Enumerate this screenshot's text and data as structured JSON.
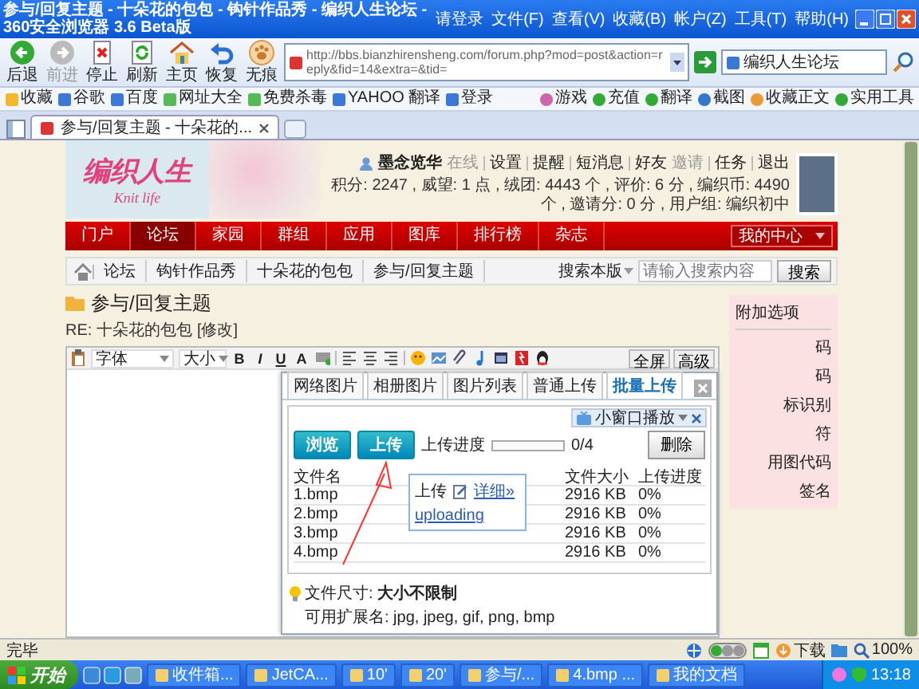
{
  "window": {
    "title": "参与/回复主题 - 十朵花的包包 - 钩针作品秀 - 编织人生论坛 - 360安全浏览器 3.6 Beta版",
    "menu": [
      "请登录",
      "文件(F)",
      "查看(V)",
      "收藏(B)",
      "帐户(Z)",
      "工具(T)",
      "帮助(H)"
    ]
  },
  "toolbar": [
    {
      "kind": "back",
      "label": "后退",
      "disabled": false
    },
    {
      "kind": "forward",
      "label": "前进",
      "disabled": true
    },
    {
      "kind": "stop",
      "label": "停止",
      "disabled": false
    },
    {
      "kind": "refresh",
      "label": "刷新",
      "disabled": false
    },
    {
      "kind": "home",
      "label": "主页",
      "disabled": false
    },
    {
      "kind": "restore",
      "label": "恢复",
      "disabled": false
    },
    {
      "kind": "incognito",
      "label": "无痕",
      "disabled": false
    }
  ],
  "address": {
    "url": "http://bbs.bianzhirensheng.com/forum.php?mod=post&action=reply&fid=14&extra=&tid="
  },
  "search": {
    "value": "编织人生论坛"
  },
  "favorites_bar": {
    "left": [
      "收藏",
      "谷歌",
      "百度",
      "网址大全",
      "免费杀毒",
      "YAHOO 翻译",
      "登录"
    ],
    "right": [
      "游戏",
      "充值",
      "翻译",
      "截图",
      "收藏正文",
      "实用工具"
    ]
  },
  "tabs": [
    {
      "label": "参与/回复主题 - 十朵花的...",
      "selected": true
    }
  ],
  "header": {
    "logo": {
      "text": "编织人生",
      "subtitle": "Knit life"
    },
    "user": {
      "name": "墨念览华",
      "status": "在线",
      "links": [
        "设置",
        "提醒",
        "短消息",
        "好友",
        "邀请",
        "任务",
        "退出"
      ]
    },
    "stats": "积分: 2247 , 威望: 1 点 , 绒团: 4443 个 , 评价: 6 分 , 编织币: 4490 个 , 邀请分: 0 分 , 用户组: 编织初中"
  },
  "nav": {
    "items": [
      {
        "label": "门户",
        "selected": false
      },
      {
        "label": "论坛",
        "selected": true
      },
      {
        "label": "家园",
        "selected": false
      },
      {
        "label": "群组",
        "selected": false
      },
      {
        "label": "应用",
        "selected": false
      },
      {
        "label": "图库",
        "selected": false
      },
      {
        "label": "排行榜",
        "selected": false
      },
      {
        "label": "杂志",
        "selected": false
      }
    ],
    "my_center": "我的中心"
  },
  "breadcrumb": {
    "items": [
      "论坛",
      "钩针作品秀",
      "十朵花的包包",
      "参与/回复主题"
    ],
    "search_scope": "搜索本版",
    "search_placeholder": "请输入搜索内容",
    "search_button": "搜索"
  },
  "post": {
    "title": "参与/回复主题",
    "subject": "RE: 十朵花的包包",
    "edit_link": "[修改]"
  },
  "editor": {
    "font": "字体",
    "size": "大小",
    "format_buttons": [
      "B",
      "I",
      "U",
      "A"
    ],
    "fullscreen": "全屏",
    "advanced": "高级"
  },
  "upload_dialog": {
    "tabs": [
      {
        "label": "网络图片",
        "selected": false
      },
      {
        "label": "相册图片",
        "selected": false
      },
      {
        "label": "图片列表",
        "selected": false
      },
      {
        "label": "普通上传",
        "selected": false
      },
      {
        "label": "批量上传",
        "selected": true
      }
    ],
    "mini_player": "小窗口播放",
    "browse": "浏览",
    "upload": "上传",
    "progress_label": "上传进度",
    "progress": {
      "level": 0,
      "reading": "0/4"
    },
    "delete": "删除",
    "columns": [
      "文件名",
      "文件大小",
      "上传进度"
    ],
    "files": [
      {
        "name": "1.bmp",
        "size": "2916 KB",
        "progress": "0%"
      },
      {
        "name": "2.bmp",
        "size": "2916 KB",
        "progress": "0%"
      },
      {
        "name": "3.bmp",
        "size": "2916 KB",
        "progress": "0%"
      },
      {
        "name": "4.bmp",
        "size": "2916 KB",
        "progress": "0%"
      }
    ],
    "tooltip": {
      "title": "上传",
      "details": "详细»",
      "status": "uploading"
    },
    "size_limit": {
      "label": "文件尺寸:",
      "value": "大小不限制"
    },
    "extensions": "可用扩展名: jpg, jpeg, gif, png, bmp"
  },
  "side_panel": {
    "title": "附加选项",
    "options": [
      "码",
      "码",
      "标识别",
      "符",
      "用图代码",
      "签名"
    ]
  },
  "status_bar": {
    "text": "完毕",
    "download": "下载",
    "zoom": "100%"
  },
  "taskbar": {
    "start": "开始",
    "tasks": [
      "收件箱...",
      "JetCA...",
      "10'",
      "20'",
      "参与/...",
      "4.bmp ...",
      "我的文档"
    ],
    "clock": "13:18"
  }
}
